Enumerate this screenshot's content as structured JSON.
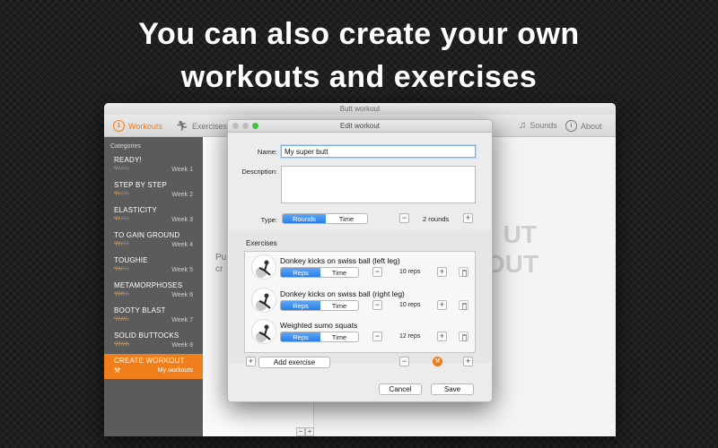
{
  "headline": {
    "line1": "You can also create your own",
    "line2": "workouts and exercises"
  },
  "window": {
    "title": "Butt workout"
  },
  "toolbar": {
    "workouts": "Workouts",
    "exercises": "Exercises",
    "sounds": "Sounds",
    "about": "About"
  },
  "sidebar": {
    "heading": "Categories",
    "items": [
      {
        "name": "READY!",
        "week": "Week 1",
        "level": 1
      },
      {
        "name": "STEP BY STEP",
        "week": "Week 2",
        "level": 2
      },
      {
        "name": "ELASTICITY",
        "week": "Week 3",
        "level": 2
      },
      {
        "name": "TO GAIN GROUND",
        "week": "Week 4",
        "level": 3
      },
      {
        "name": "TOUGHIE",
        "week": "Week 5",
        "level": 3
      },
      {
        "name": "METAMORPHOSES",
        "week": "Week 6",
        "level": 4
      },
      {
        "name": "BOOTY BLAST",
        "week": "Week 7",
        "level": 5
      },
      {
        "name": "SOLID BUTTOCKS",
        "week": "Week 8",
        "level": 6
      }
    ],
    "create": {
      "name": "CREATE WORKOUT",
      "sub": "My workouts"
    }
  },
  "middle": {
    "line1": "Pu",
    "line2": "cr"
  },
  "ghost": {
    "line1": "UT",
    "line2": "KOUT"
  },
  "dialog": {
    "title": "Edit workout",
    "name_label": "Name:",
    "name_value": "My super butt",
    "description_label": "Description:",
    "description_value": "",
    "type_label": "Type:",
    "type_rounds": "Rounds",
    "type_time": "Time",
    "rounds_value": "2 rounds",
    "exercises_label": "Exercises",
    "exercises": [
      {
        "name": "Donkey kicks on swiss ball (left leg)",
        "reps_label": "Reps",
        "time_label": "Time",
        "count": "10 reps"
      },
      {
        "name": "Donkey kicks on swiss ball (right leg)",
        "reps_label": "Reps",
        "time_label": "Time",
        "count": "10 reps"
      },
      {
        "name": "Weighted sumo squats",
        "reps_label": "Reps",
        "time_label": "Time",
        "count": "12 reps"
      }
    ],
    "add_exercise": "Add exercise",
    "cancel": "Cancel",
    "save": "Save"
  },
  "colors": {
    "accent": "#f07f1b",
    "selection": "#2a7fe7"
  }
}
